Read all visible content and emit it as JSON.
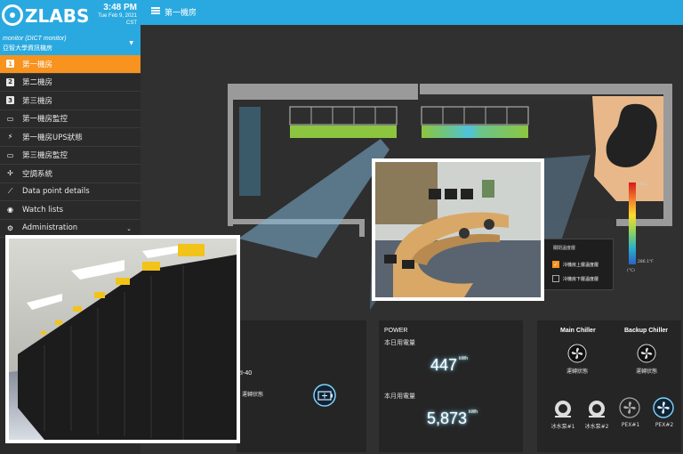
{
  "brand": {
    "logo_text": "ZLABS"
  },
  "clock": {
    "time": "3:48 PM",
    "date": "Tue Feb 9, 2021",
    "zone": "CST"
  },
  "profile": {
    "role": "monitor (DICT monitor)",
    "org": "亞智大學資訊機房"
  },
  "topbar": {
    "title": "第一機房"
  },
  "menu": [
    {
      "label": "第一機房",
      "icon": "number-1-icon",
      "glyph": "1",
      "active": true
    },
    {
      "label": "第二機房",
      "icon": "number-2-icon",
      "glyph": "2",
      "active": false
    },
    {
      "label": "第三機房",
      "icon": "number-3-icon",
      "glyph": "3",
      "active": false
    },
    {
      "label": "第一機房監控",
      "icon": "monitor-icon",
      "glyph": "▭",
      "active": false
    },
    {
      "label": "第一機房UPS狀態",
      "icon": "bolt-icon",
      "glyph": "⚡",
      "active": false
    },
    {
      "label": "第三機房監控",
      "icon": "monitor-icon",
      "glyph": "▭",
      "active": false
    },
    {
      "label": "空調系統",
      "icon": "fan-icon",
      "glyph": "✢",
      "active": false
    },
    {
      "label": "Data point details",
      "icon": "line-chart-icon",
      "glyph": "⟋",
      "active": false
    },
    {
      "label": "Watch lists",
      "icon": "eye-icon",
      "glyph": "◉",
      "active": false
    },
    {
      "label": "Administration",
      "icon": "gear-icon",
      "glyph": "⚙",
      "active": false,
      "expandable": true
    }
  ],
  "legend": {
    "heading": "關閉溫度層",
    "options": [
      {
        "label": "冷機房上層溫度層",
        "checked": true
      },
      {
        "label": "冷機房下層溫度層",
        "checked": false
      }
    ]
  },
  "temp_scale": {
    "max": "288.2",
    "min": "286.1°F",
    "unit": "(°C)"
  },
  "ups_panel": {
    "title": "RI-40",
    "status_label": "運轉狀態"
  },
  "power_panel": {
    "title": "POWER",
    "daily_label": "本日用電量",
    "daily_value": "447",
    "monthly_label": "本月用電量",
    "monthly_value": "5,873",
    "unit": "kWh"
  },
  "chiller_panel": {
    "main_title": "Main Chiller",
    "backup_title": "Backup Chiller",
    "main_status": "運轉狀態",
    "backup_status": "運轉狀態",
    "pumps": [
      {
        "label": "冰水泵#1",
        "icon": "pump-icon"
      },
      {
        "label": "冰水泵#2",
        "icon": "pump-icon"
      },
      {
        "label": "PEX#1",
        "icon": "fan-icon"
      },
      {
        "label": "PEX#2",
        "icon": "fan-icon"
      }
    ]
  },
  "colors": {
    "accent_blue": "#29a9df",
    "active_orange": "#f7931e",
    "rack_green": "#8cc63f",
    "room_beige": "#e8b88a"
  }
}
